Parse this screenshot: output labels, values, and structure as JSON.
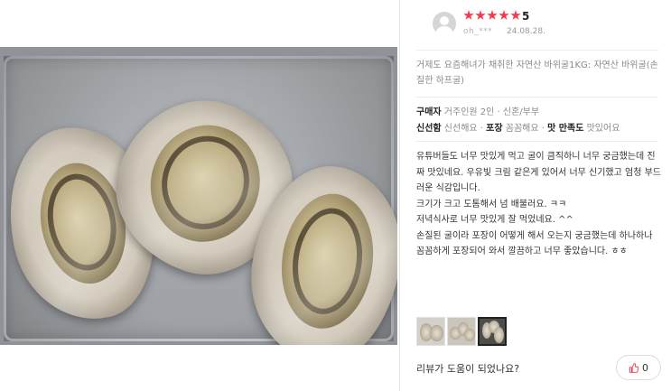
{
  "review": {
    "rating_stars": 5,
    "score": "5",
    "user": "oh_***",
    "date": "24.08.28.",
    "product_name": "거제도 요즘해녀가 채취한 자연산 바위굴1KG: 자연산 바위굴(손질한 하프굴)",
    "meta": {
      "buyer_label": "구매자",
      "buyer_value": "거주인원 2인 · 신혼/부부",
      "freshness_label": "신선함",
      "freshness_value": "신선해요",
      "sep1": " · ",
      "packaging_label": "포장",
      "packaging_value": "꼼꼼해요",
      "sep2": " · ",
      "taste_label": "맛 만족도",
      "taste_value": "맛있어요"
    },
    "content": [
      "유튜버들도 너무 맛있게 먹고 굴이 큼직하니 너무 궁금했는데 진짜 맛있네요. 우유빛 크림 같은게 있어서 너무 신기했고 엄청 부드러운 식감입니다.",
      "크기가 크고 도톰해서 넘 배불러요. ㅋㅋ",
      "저녁식사로 너무 맛있게 잘 먹었네요. ^^",
      " 손질된 굴이라 포장이 어떻게 해서 오는지 궁금했는데 하나하나 꼼꼼하게 포장되어 와서 깔끔하고 너무 좋았습니다. ㅎㅎ"
    ],
    "thumbnails": [
      {
        "name": "review-photo-1",
        "selected": false
      },
      {
        "name": "review-photo-2",
        "selected": false
      },
      {
        "name": "review-photo-3",
        "selected": true
      }
    ],
    "helpful_question": "리뷰가 도움이 되었나요?",
    "like_count": "0"
  },
  "colors": {
    "star": "#f5384a",
    "like_icon": "#f5384a",
    "muted_text": "#8a8a8a"
  },
  "icons": {
    "avatar": "user-avatar-icon",
    "like": "thumbs-up-icon"
  }
}
